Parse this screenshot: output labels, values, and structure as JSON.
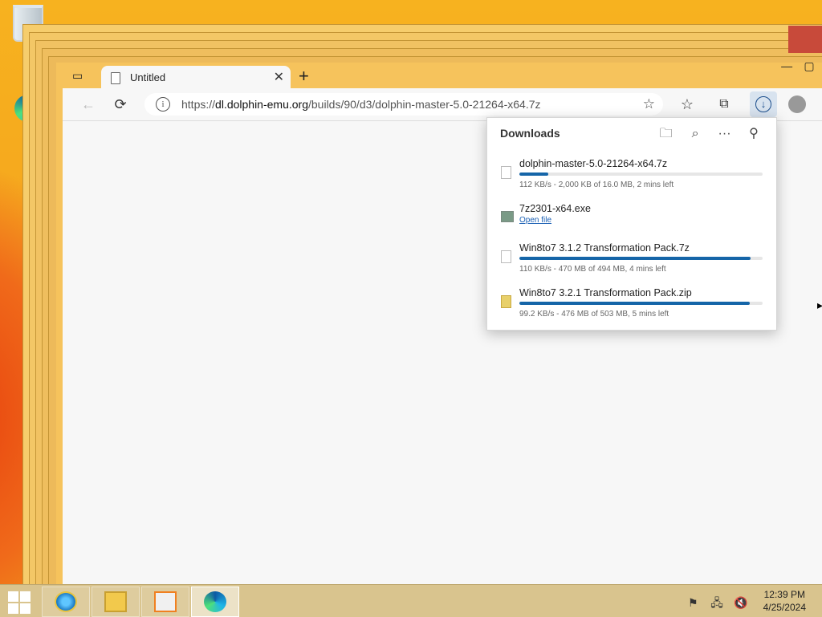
{
  "desktop": {
    "icons": [
      {
        "label": "Recycle Bin",
        "icon": "recycle-bin-icon"
      },
      {
        "label": "Microsoft Edge",
        "icon": "edge-icon"
      }
    ]
  },
  "browser": {
    "tab": {
      "title": "Untitled",
      "close_symbol": "✕"
    },
    "new_tab_symbol": "+",
    "window_controls": {
      "minimize": "—",
      "maximize": "▢"
    },
    "address": {
      "protocol": "https://",
      "host": "dl.dolphin-emu.org",
      "path": "/builds/90/d3/dolphin-master-5.0-21264-x64.7z"
    },
    "icons": {
      "back": "←",
      "reload": "⟳",
      "info": "i",
      "add_favorite": "☆",
      "favorites": "☆",
      "collections": "⧉",
      "downloads": "↓"
    }
  },
  "downloads_panel": {
    "title": "Downloads",
    "header_icons": {
      "folder": "🗀",
      "search": "⌕",
      "more": "···",
      "pin": "⚲"
    },
    "items": [
      {
        "name": "dolphin-master-5.0-21264-x64.7z",
        "status": "112 KB/s - 2,000 KB of 16.0 MB, 2 mins left",
        "progress": 0.12,
        "type": "file"
      },
      {
        "name": "7z2301-x64.exe",
        "action": "Open file",
        "type": "exe"
      },
      {
        "name": "Win8to7 3.1.2 Transformation Pack.7z",
        "status": "110 KB/s - 470 MB of 494 MB, 4 mins left",
        "progress": 0.95,
        "type": "file"
      },
      {
        "name": "Win8to7 3.2.1 Transformation Pack.zip",
        "status": "99.2 KB/s - 476 MB of 503 MB, 5 mins left",
        "progress": 0.946,
        "type": "zip"
      }
    ]
  },
  "taskbar": {
    "apps": [
      "internet-explorer",
      "file-explorer",
      "media-player",
      "microsoft-edge"
    ],
    "tray_icons": {
      "flag": "⚑",
      "network": "🖧",
      "volume": "🔇"
    },
    "clock": {
      "time": "12:39 PM",
      "date": "4/25/2024"
    }
  }
}
